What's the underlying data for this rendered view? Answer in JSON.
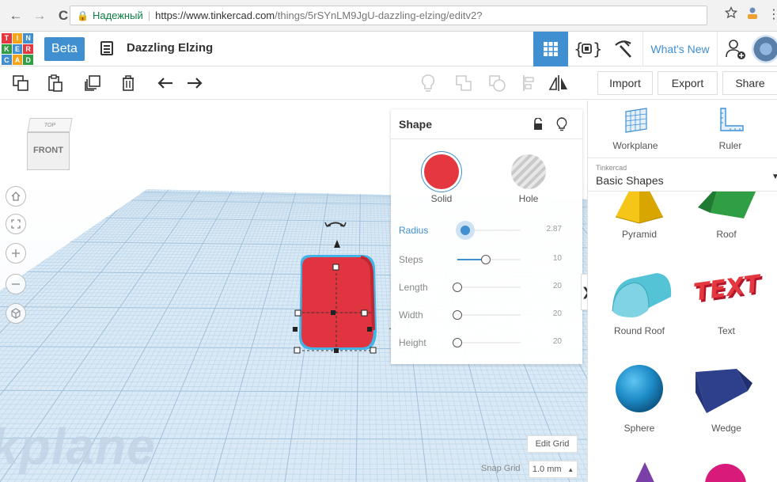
{
  "browser": {
    "back_glyph": "←",
    "forward_glyph": "→",
    "reload_glyph": "C",
    "secure_label": "Надежный",
    "url_host": "https://www.tinkercad.com",
    "url_path": "/things/5rSYnLM9JgU-dazzling-elzing/editv2?"
  },
  "header": {
    "logo_letters": [
      "T",
      "I",
      "N",
      "K",
      "E",
      "R",
      "C",
      "A",
      "D"
    ],
    "beta_label": "Beta",
    "design_title": "Dazzling Elzing",
    "whats_new_label": "What's New"
  },
  "toolbar": {
    "import_label": "Import",
    "export_label": "Export",
    "share_label": "Share"
  },
  "viewport": {
    "viewcube_top": "TOP",
    "viewcube_front": "FRONT",
    "workplane_watermark": "kplane",
    "edit_grid_label": "Edit Grid",
    "snap_grid_label": "Snap Grid",
    "snap_grid_value": "1.0 mm",
    "snap_grid_caret": "▲"
  },
  "inspector": {
    "title": "Shape",
    "solid_label": "Solid",
    "hole_label": "Hole",
    "params": [
      {
        "label": "Radius",
        "value": "2.87",
        "fraction": 0.12,
        "active": true
      },
      {
        "label": "Steps",
        "value": "10",
        "fraction": 0.45,
        "active": false
      },
      {
        "label": "Length",
        "value": "20",
        "fraction": 0.0,
        "active": false
      },
      {
        "label": "Width",
        "value": "20",
        "fraction": 0.0,
        "active": false
      },
      {
        "label": "Height",
        "value": "20",
        "fraction": 0.0,
        "active": false
      }
    ],
    "collapse_glyph": "❯"
  },
  "sidebar": {
    "workplane_label": "Workplane",
    "ruler_label": "Ruler",
    "library_caption": "Tinkercad",
    "library_name": "Basic Shapes",
    "library_caret": "▼",
    "shapes": [
      {
        "label": "Pyramid"
      },
      {
        "label": "Roof"
      },
      {
        "label": "Round Roof"
      },
      {
        "label": "Text"
      },
      {
        "label": "Sphere"
      },
      {
        "label": "Wedge"
      }
    ],
    "text_shape_glyph": "TEXT"
  },
  "colors": {
    "accent": "#3f8fd1",
    "solid_red": "#e5373f",
    "selection": "#44b4e6"
  }
}
